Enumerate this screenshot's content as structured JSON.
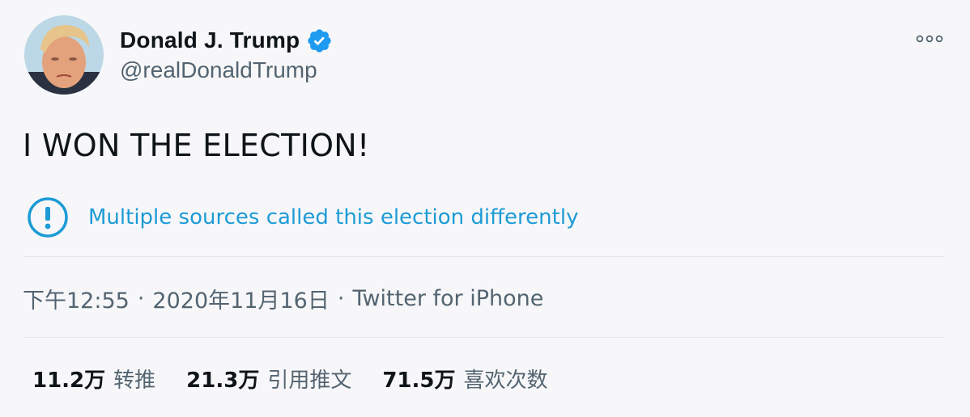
{
  "author": {
    "display_name": "Donald J. Trump",
    "handle": "@realDonaldTrump",
    "verified": true,
    "avatar_icon": "profile-photo"
  },
  "menu": {
    "more_icon": "ellipsis-icon"
  },
  "tweet": {
    "text": "I WON THE ELECTION!"
  },
  "notice": {
    "icon": "exclamation-circle-icon",
    "text": "Multiple sources called this election differently"
  },
  "meta": {
    "time": "下午12:55",
    "separator": "·",
    "date": "2020年11月16日",
    "source": "Twitter for iPhone"
  },
  "stats": [
    {
      "value": "11.2万",
      "label": "转推"
    },
    {
      "value": "21.3万",
      "label": "引用推文"
    },
    {
      "value": "71.5万",
      "label": "喜欢次数"
    }
  ],
  "colors": {
    "background": "#f7f7f9",
    "text_primary": "#0f1419",
    "text_secondary": "#536471",
    "accent_blue": "#1d9bd6",
    "verified_blue": "#1d9bf0",
    "divider": "#e3e6e9"
  }
}
